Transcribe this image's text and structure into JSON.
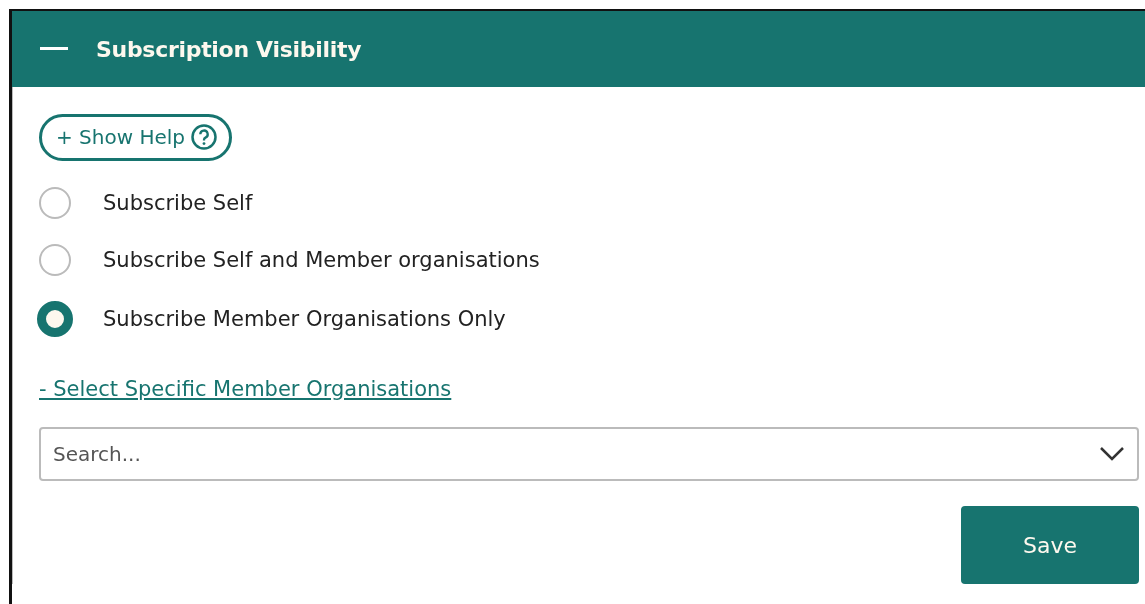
{
  "panel": {
    "title": "Subscription Visibility",
    "expanded": true
  },
  "help_button": {
    "label": "+ Show Help"
  },
  "options": [
    {
      "label": "Subscribe Self",
      "selected": false
    },
    {
      "label": "Subscribe Self and Member organisations",
      "selected": false
    },
    {
      "label": "Subscribe Member Organisations Only",
      "selected": true
    }
  ],
  "select_link": {
    "label": "- Select Specific Member Organisations"
  },
  "search": {
    "placeholder": "Search..."
  },
  "buttons": [
    {
      "label": "Save"
    }
  ]
}
